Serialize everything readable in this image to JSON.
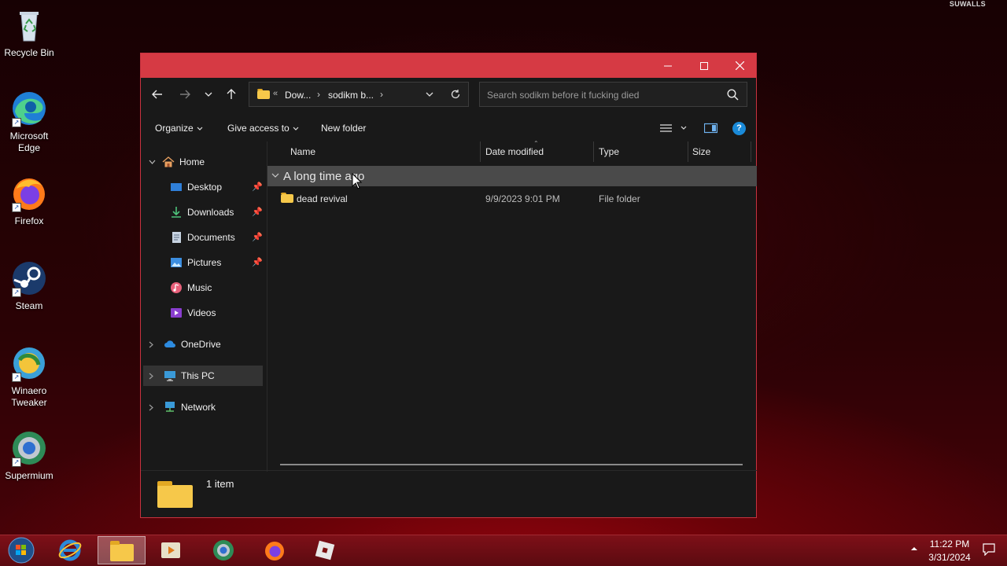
{
  "watermark": "SUWALLS",
  "desktop": {
    "icons": [
      {
        "label_lines": [
          "Recycle Bin"
        ],
        "icon": "recycle-bin-icon"
      },
      {
        "label_lines": [
          "Microsoft",
          "Edge"
        ],
        "icon": "edge-icon"
      },
      {
        "label_lines": [
          "Firefox"
        ],
        "icon": "firefox-icon"
      },
      {
        "label_lines": [
          "Steam"
        ],
        "icon": "steam-icon"
      },
      {
        "label_lines": [
          "Winaero",
          "Tweaker"
        ],
        "icon": "winaero-tweaker-icon"
      },
      {
        "label_lines": [
          "Supermium"
        ],
        "icon": "supermium-icon"
      }
    ]
  },
  "window": {
    "address": {
      "crumb_prefix": "«",
      "crumbs": [
        "Dow...",
        "sodikm b..."
      ]
    },
    "search_placeholder": "Search sodikm before it fucking died",
    "commands": {
      "organize": "Organize",
      "give_access": "Give access to",
      "new_folder": "New folder"
    },
    "nav": {
      "home": "Home",
      "quick": [
        {
          "label": "Desktop",
          "pinned": true
        },
        {
          "label": "Downloads",
          "pinned": true
        },
        {
          "label": "Documents",
          "pinned": true
        },
        {
          "label": "Pictures",
          "pinned": true
        },
        {
          "label": "Music",
          "pinned": false
        },
        {
          "label": "Videos",
          "pinned": false
        }
      ],
      "onedrive": "OneDrive",
      "this_pc": "This PC",
      "network": "Network"
    },
    "columns": {
      "name": "Name",
      "date": "Date modified",
      "type": "Type",
      "size": "Size"
    },
    "group": "A long time ago",
    "files": [
      {
        "name": "dead revival",
        "date": "9/9/2023 9:01 PM",
        "type": "File folder",
        "size": ""
      }
    ],
    "status": "1 item"
  },
  "taskbar": {
    "time": "11:22 PM",
    "date": "3/31/2024",
    "colors": {
      "accent": "#d63a44",
      "taskbar": "#6e0d14"
    }
  }
}
